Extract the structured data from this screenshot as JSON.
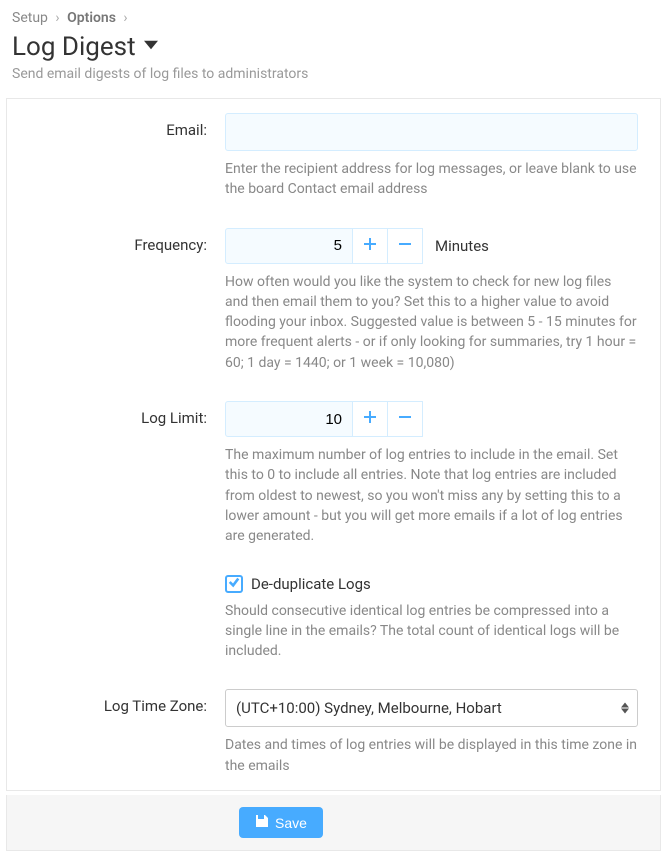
{
  "breadcrumb": {
    "items": [
      "Setup",
      "Options"
    ],
    "sep": "›"
  },
  "page": {
    "title": "Log Digest",
    "desc": "Send email digests of log files to administrators"
  },
  "fields": {
    "email": {
      "label": "Email:",
      "value": "",
      "help": "Enter the recipient address for log messages, or leave blank to use the board Contact email address"
    },
    "frequency": {
      "label": "Frequency:",
      "value": "5",
      "suffix": "Minutes",
      "help": "How often would you like the system to check for new log files and then email them to you? Set this to a higher value to avoid flooding your inbox. Suggested value is between 5 - 15 minutes for more frequent alerts - or if only looking for summaries, try 1 hour = 60; 1 day = 1440; or 1 week = 10,080)"
    },
    "log_limit": {
      "label": "Log Limit:",
      "value": "10",
      "help": "The maximum number of log entries to include in the email. Set this to 0 to include all entries. Note that log entries are included from oldest to newest, so you won't miss any by setting this to a lower amount - but you will get more emails if a lot of log entries are generated."
    },
    "dedup": {
      "label": "De-duplicate Logs",
      "help": "Should consecutive identical log entries be compressed into a single line in the emails? The total count of identical logs will be included."
    },
    "timezone": {
      "label": "Log Time Zone:",
      "value": "(UTC+10:00) Sydney, Melbourne, Hobart",
      "help": "Dates and times of log entries will be displayed in this time zone in the emails"
    }
  },
  "actions": {
    "save": "Save"
  }
}
